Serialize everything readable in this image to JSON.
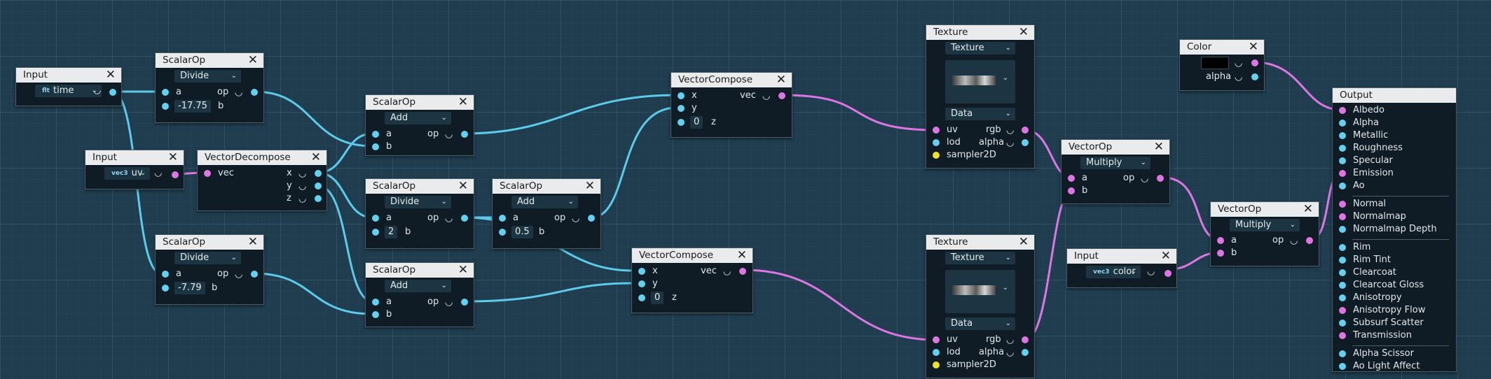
{
  "editor": {
    "nodes": {
      "input_time": {
        "title": "Input",
        "type_tag": "flt",
        "value": "time"
      },
      "scalar_div1": {
        "title": "ScalarOp",
        "op": "Divide",
        "a_label": "a",
        "a_value": "-17.75",
        "b_label": "b",
        "out_label": "op"
      },
      "input_uv": {
        "title": "Input",
        "type_tag": "vec3",
        "value": "uv"
      },
      "vec_decompose": {
        "title": "VectorDecompose",
        "in_label": "vec",
        "x_label": "x",
        "y_label": "y",
        "z_label": "z"
      },
      "scalar_div2": {
        "title": "ScalarOp",
        "op": "Divide",
        "a_label": "a",
        "a_value": "-7.79",
        "b_label": "b",
        "out_label": "op"
      },
      "scalar_add1": {
        "title": "ScalarOp",
        "op": "Add",
        "a_label": "a",
        "b_label": "b",
        "out_label": "op"
      },
      "scalar_div3": {
        "title": "ScalarOp",
        "op": "Divide",
        "a_label": "a",
        "b_value": "2",
        "b_label": "b",
        "out_label": "op"
      },
      "scalar_add2": {
        "title": "ScalarOp",
        "op": "Add",
        "a_label": "a",
        "b_label": "b",
        "out_label": "op"
      },
      "scalar_add3": {
        "title": "ScalarOp",
        "op": "Add",
        "a_label": "a",
        "b_value": "0.5",
        "b_label": "b",
        "out_label": "op"
      },
      "vec_compose1": {
        "title": "VectorCompose",
        "x_label": "x",
        "y_label": "y",
        "z_value": "0",
        "z_label": "z",
        "out_label": "vec"
      },
      "vec_compose2": {
        "title": "VectorCompose",
        "x_label": "x",
        "y_label": "y",
        "z_value": "0",
        "z_label": "z",
        "out_label": "vec"
      },
      "texture1": {
        "title": "Texture",
        "type": "Texture",
        "data": "Data",
        "uv": "uv",
        "lod": "lod",
        "sampler": "sampler2D",
        "rgb": "rgb",
        "alpha": "alpha"
      },
      "texture2": {
        "title": "Texture",
        "type": "Texture",
        "data": "Data",
        "uv": "uv",
        "lod": "lod",
        "sampler": "sampler2D",
        "rgb": "rgb",
        "alpha": "alpha"
      },
      "color": {
        "title": "Color",
        "alpha_label": "alpha",
        "swatch": "#000000"
      },
      "vector_op": {
        "title": "VectorOp",
        "op": "Multiply",
        "a_label": "a",
        "b_label": "b",
        "out_label": "op"
      },
      "input_color": {
        "title": "Input",
        "type_tag": "vec3",
        "value": "color"
      },
      "vector_op2": {
        "title": "VectorOp",
        "op": "Multiply",
        "a_label": "a",
        "b_label": "b",
        "out_label": "op"
      },
      "output": {
        "title": "Output",
        "inputs": [
          "Albedo",
          "Alpha",
          "Metallic",
          "Roughness",
          "Specular",
          "Emission",
          "Ao",
          "Normal",
          "Normalmap",
          "Normalmap Depth",
          "Rim",
          "Rim Tint",
          "Clearcoat",
          "Clearcoat Gloss",
          "Anisotropy",
          "Anisotropy Flow",
          "Subsurf Scatter",
          "Transmission",
          "Alpha Scissor",
          "Ao Light Affect"
        ]
      }
    },
    "colors": {
      "scalar_port": "#62d0ee",
      "vector_port": "#dd76e3",
      "sampler_port": "#eee32b",
      "background": "#1f3d4e"
    }
  }
}
